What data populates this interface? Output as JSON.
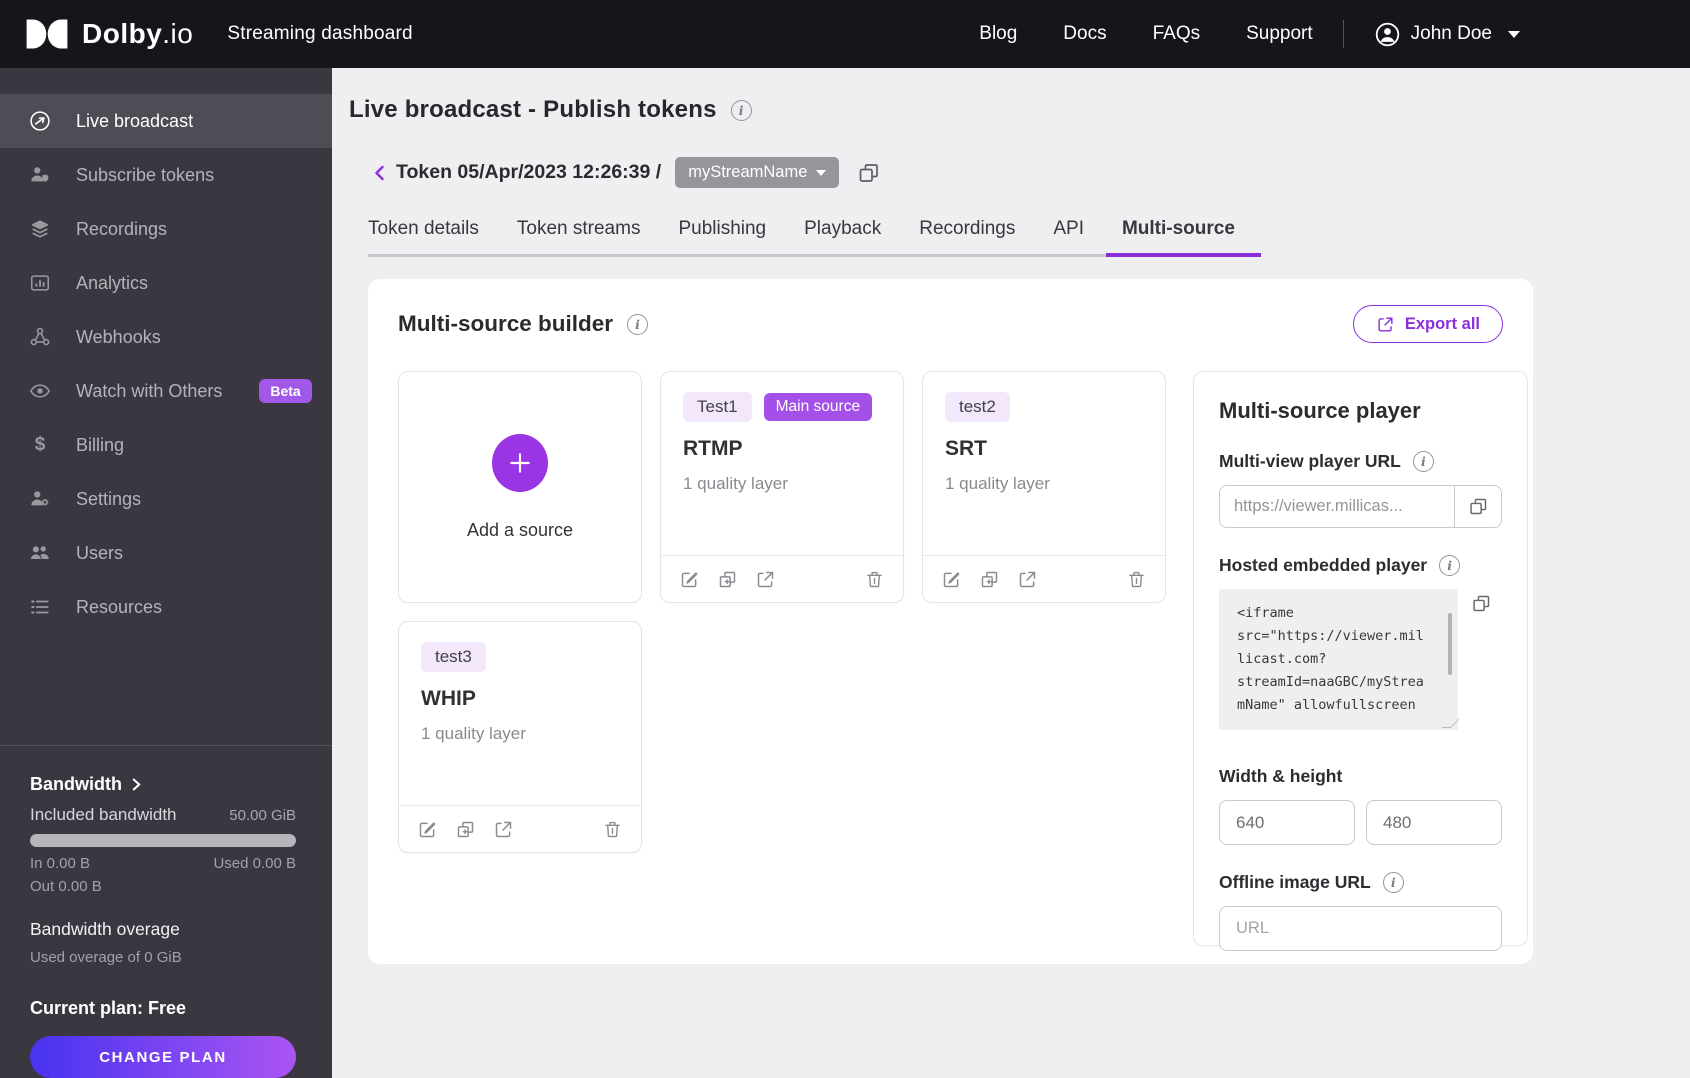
{
  "header": {
    "logo": {
      "brand": "Dolby",
      "suffix": ".io"
    },
    "product": "Streaming dashboard",
    "nav": [
      {
        "label": "Blog"
      },
      {
        "label": "Docs"
      },
      {
        "label": "FAQs"
      },
      {
        "label": "Support"
      }
    ],
    "user_name": "John Doe"
  },
  "sidebar": {
    "items": [
      {
        "label": "Live broadcast"
      },
      {
        "label": "Subscribe tokens"
      },
      {
        "label": "Recordings"
      },
      {
        "label": "Analytics"
      },
      {
        "label": "Webhooks"
      },
      {
        "label": "Watch with Others",
        "badge": "Beta"
      },
      {
        "label": "Billing"
      },
      {
        "label": "Settings"
      },
      {
        "label": "Users"
      },
      {
        "label": "Resources"
      }
    ],
    "bandwidth": {
      "title": "Bandwidth",
      "included_label": "Included bandwidth",
      "included_value": "50.00 GiB",
      "in_label": "In 0.00 B",
      "used_label": "Used 0.00 B",
      "out_label": "Out 0.00 B",
      "overage_title": "Bandwidth overage",
      "overage_detail": "Used overage of 0 GiB"
    },
    "plan": {
      "current": "Current plan: Free",
      "cta": "CHANGE PLAN"
    }
  },
  "main": {
    "title": "Live broadcast - Publish tokens",
    "token": {
      "breadcrumb": "Token 05/Apr/2023 12:26:39 /",
      "stream_name": "myStreamName"
    },
    "tabs": [
      {
        "label": "Token details"
      },
      {
        "label": "Token streams"
      },
      {
        "label": "Publishing"
      },
      {
        "label": "Playback"
      },
      {
        "label": "Recordings"
      },
      {
        "label": "API"
      },
      {
        "label": "Multi-source",
        "active": true
      }
    ],
    "builder": {
      "title": "Multi-source builder",
      "export_label": "Export all",
      "add_source_label": "Add a source",
      "sources": [
        {
          "name": "Test1",
          "badge": "Main source",
          "protocol": "RTMP",
          "quality": "1 quality layer"
        },
        {
          "name": "test2",
          "protocol": "SRT",
          "quality": "1 quality layer"
        },
        {
          "name": "test3",
          "protocol": "WHIP",
          "quality": "1 quality layer"
        }
      ]
    },
    "player": {
      "title": "Multi-source player",
      "url_label": "Multi-view player URL",
      "url_value": "https://viewer.millicas...",
      "embed_label": "Hosted embedded player",
      "embed_code": "<iframe\nsrc=\"https://viewer.mil\nlicast.com?\nstreamId=naaGBC/myStrea\nmName\" allowfullscreen",
      "size_label": "Width & height",
      "width_value": "640",
      "height_value": "480",
      "offline_label": "Offline image URL",
      "offline_placeholder": "URL"
    }
  },
  "colors": {
    "accent_purple": "#8b2fd6",
    "badge_purple": "#a44fe8",
    "beta_purple": "#a158e8",
    "gradient_start": "#4733f0",
    "gradient_end": "#ab55f2",
    "header_bg": "#17151b",
    "sidebar_bg": "#3a3741"
  }
}
